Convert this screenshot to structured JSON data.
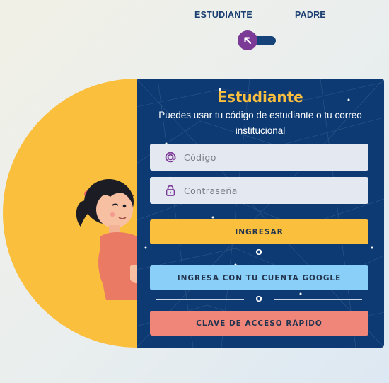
{
  "roles": {
    "student": "ESTUDIANTE",
    "parent": "PADRE"
  },
  "toggle": {
    "icon": "arrow-up-left-icon",
    "color": "#7b3a96",
    "track_color": "#16427a"
  },
  "panel": {
    "title": "Estudiante",
    "subtitle": "Puedes usar tu código de estudiante o tu correo institucional",
    "code_field": {
      "placeholder": "Código",
      "value": "",
      "icon": "at-icon"
    },
    "password_field": {
      "placeholder": "Contraseña",
      "value": "",
      "icon": "lock-icon"
    },
    "login_button": "INGRESAR",
    "or_1": "O",
    "google_button": "INGRESA CON TU CUENTA GOOGLE",
    "or_2": "O",
    "quick_key_button": "CLAVE DE ACCESO RÁPIDO"
  },
  "colors": {
    "panel_bg": "#0d3a73",
    "accent_yellow": "#fbbf3e",
    "google_blue": "#8acff8",
    "quick_salmon": "#f0857a",
    "icon_purple": "#7b3a96"
  }
}
